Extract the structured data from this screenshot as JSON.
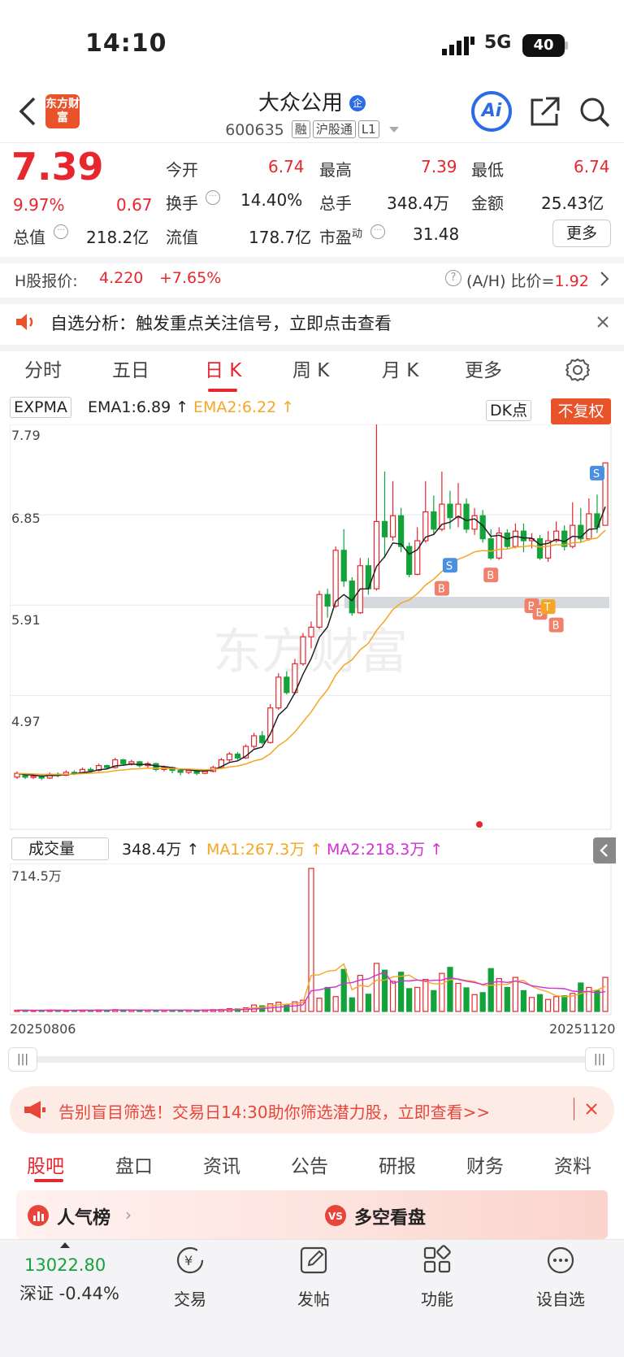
{
  "status_bar": {
    "time": "14:10",
    "network": "5G",
    "battery": "40"
  },
  "header": {
    "logo_text": "东方财富",
    "title": "大众公用",
    "title_badge": "企",
    "code": "600635",
    "tags": [
      "融",
      "沪股通",
      "L1"
    ],
    "ai_label": "Ai"
  },
  "quote": {
    "price": "7.39",
    "change_pct": "9.97%",
    "change": "0.67",
    "open_label": "今开",
    "open": "6.74",
    "high_label": "最高",
    "high": "7.39",
    "low_label": "最低",
    "low": "6.74",
    "turnover_label": "换手",
    "turnover": "14.40%",
    "volume_label": "总手",
    "volume": "348.4万",
    "amount_label": "金额",
    "amount": "25.43亿",
    "mktcap_label": "总值",
    "mktcap": "218.2亿",
    "float_label": "流值",
    "float": "178.7亿",
    "pe_label": "市盈",
    "pe_sup": "动",
    "pe": "31.48",
    "more_label": "更多"
  },
  "hshare": {
    "label": "H股报价:",
    "price": "4.220",
    "change": "+7.65%",
    "ratio_label": "(A/H) 比价=",
    "ratio": "1.92"
  },
  "notice": {
    "text": "自选分析：触发重点关注信号，立即点击查看"
  },
  "chart_tabs": [
    "分时",
    "五日",
    "日 K",
    "周 K",
    "月 K",
    "更多"
  ],
  "chart_toolbar": {
    "indicator": "EXPMA",
    "ema1": "EMA1:6.89",
    "ema2": "EMA2:6.22",
    "dk_label": "DK点",
    "fq_label": "不复权"
  },
  "colors": {
    "up": "#e8262d",
    "down": "#13a33a",
    "ema1": "#222222",
    "ema2": "#f5a623",
    "ma2": "#d22fd6"
  },
  "chart_data": [
    {
      "type": "candlestick",
      "title": "",
      "y_ticks": [
        "7.79",
        "6.85",
        "5.91",
        "4.97"
      ],
      "ylim": [
        4.0,
        7.79
      ],
      "watermark": "东方财富",
      "candles": [
        [
          4.12,
          4.16,
          4.1,
          4.18
        ],
        [
          4.14,
          4.12,
          4.1,
          4.16
        ],
        [
          4.12,
          4.13,
          4.1,
          4.15
        ],
        [
          4.13,
          4.11,
          4.09,
          4.15
        ],
        [
          4.11,
          4.15,
          4.1,
          4.17
        ],
        [
          4.15,
          4.14,
          4.12,
          4.17
        ],
        [
          4.14,
          4.17,
          4.13,
          4.19
        ],
        [
          4.17,
          4.16,
          4.14,
          4.19
        ],
        [
          4.16,
          4.2,
          4.15,
          4.22
        ],
        [
          4.2,
          4.19,
          4.17,
          4.22
        ],
        [
          4.19,
          4.24,
          4.18,
          4.26
        ],
        [
          4.24,
          4.22,
          4.2,
          4.25
        ],
        [
          4.22,
          4.3,
          4.21,
          4.32
        ],
        [
          4.3,
          4.26,
          4.24,
          4.31
        ],
        [
          4.26,
          4.28,
          4.24,
          4.3
        ],
        [
          4.28,
          4.24,
          4.22,
          4.29
        ],
        [
          4.24,
          4.26,
          4.22,
          4.28
        ],
        [
          4.26,
          4.2,
          4.18,
          4.27
        ],
        [
          4.2,
          4.22,
          4.18,
          4.24
        ],
        [
          4.22,
          4.19,
          4.16,
          4.23
        ],
        [
          4.19,
          4.17,
          4.14,
          4.2
        ],
        [
          4.17,
          4.19,
          4.15,
          4.21
        ],
        [
          4.19,
          4.16,
          4.14,
          4.2
        ],
        [
          4.16,
          4.18,
          4.15,
          4.2
        ],
        [
          4.18,
          4.22,
          4.17,
          4.24
        ],
        [
          4.22,
          4.3,
          4.21,
          4.32
        ],
        [
          4.3,
          4.36,
          4.28,
          4.38
        ],
        [
          4.36,
          4.32,
          4.3,
          4.38
        ],
        [
          4.32,
          4.44,
          4.31,
          4.46
        ],
        [
          4.44,
          4.55,
          4.42,
          4.58
        ],
        [
          4.55,
          4.48,
          4.46,
          4.6
        ],
        [
          4.48,
          4.84,
          4.47,
          4.88
        ],
        [
          4.84,
          5.16,
          4.82,
          5.2
        ],
        [
          5.16,
          5.0,
          4.98,
          5.22
        ],
        [
          5.0,
          5.3,
          4.98,
          5.35
        ],
        [
          5.3,
          5.58,
          5.28,
          5.62
        ],
        [
          5.58,
          5.68,
          5.46,
          5.74
        ],
        [
          5.68,
          6.02,
          5.66,
          6.06
        ],
        [
          6.02,
          5.9,
          5.78,
          6.08
        ],
        [
          5.9,
          6.48,
          5.88,
          6.52
        ],
        [
          6.48,
          6.16,
          6.1,
          6.7
        ],
        [
          6.16,
          5.83,
          5.8,
          6.2
        ],
        [
          5.83,
          6.32,
          5.82,
          6.4
        ],
        [
          6.32,
          6.08,
          6.02,
          6.4
        ],
        [
          6.08,
          6.78,
          6.06,
          7.79
        ],
        [
          6.78,
          6.62,
          6.4,
          7.3
        ],
        [
          6.62,
          6.84,
          6.58,
          7.2
        ],
        [
          6.84,
          6.52,
          6.46,
          6.92
        ],
        [
          6.52,
          6.23,
          6.2,
          6.56
        ],
        [
          6.23,
          6.58,
          6.22,
          6.72
        ],
        [
          6.58,
          6.88,
          6.56,
          7.2
        ],
        [
          6.88,
          6.7,
          6.64,
          7.05
        ],
        [
          6.7,
          6.96,
          6.68,
          7.3
        ],
        [
          6.96,
          6.82,
          6.7,
          7.1
        ],
        [
          6.82,
          6.96,
          6.72,
          7.18
        ],
        [
          6.96,
          6.7,
          6.66,
          7.02
        ],
        [
          6.7,
          6.84,
          6.64,
          6.92
        ],
        [
          6.84,
          6.6,
          6.56,
          6.9
        ],
        [
          6.6,
          6.4,
          6.38,
          6.7
        ],
        [
          6.4,
          6.66,
          6.38,
          6.72
        ],
        [
          6.66,
          6.52,
          6.5,
          6.7
        ],
        [
          6.52,
          6.68,
          6.5,
          6.76
        ],
        [
          6.68,
          6.58,
          6.46,
          6.76
        ],
        [
          6.58,
          6.6,
          6.5,
          6.66
        ],
        [
          6.6,
          6.4,
          6.38,
          6.64
        ],
        [
          6.4,
          6.58,
          6.36,
          6.68
        ],
        [
          6.58,
          6.68,
          6.56,
          6.78
        ],
        [
          6.68,
          6.52,
          6.48,
          6.74
        ],
        [
          6.52,
          6.74,
          6.5,
          6.98
        ],
        [
          6.74,
          6.6,
          6.56,
          6.92
        ],
        [
          6.6,
          6.86,
          6.58,
          7.02
        ],
        [
          6.86,
          6.72,
          6.66,
          7.06
        ],
        [
          6.74,
          7.39,
          6.74,
          7.39
        ]
      ],
      "ema1_label": "EMA1:6.89",
      "ema2_label": "EMA2:6.22"
    },
    {
      "type": "bar",
      "title": "成交量",
      "ylabel_top": "714.5万",
      "volume_label": "348.4万",
      "ma1_label": "MA1:267.3万",
      "ma2_label": "MA2:218.3万",
      "x_start": "20250806",
      "x_end": "20251120",
      "ylim": [
        0,
        714.5
      ]
    }
  ],
  "banner": {
    "text": "告别盲目筛选！交易日14:30助你筛选潜力股，立即查看>>"
  },
  "bottom_tabs": [
    "股吧",
    "盘口",
    "资讯",
    "公告",
    "研报",
    "财务",
    "资料"
  ],
  "cards": {
    "left": "人气榜",
    "right": "多空看盘"
  },
  "nav": {
    "index_value": "13022.80",
    "index_label": "深证 -0.44%",
    "items": [
      "交易",
      "发帖",
      "功能",
      "设自选"
    ]
  }
}
